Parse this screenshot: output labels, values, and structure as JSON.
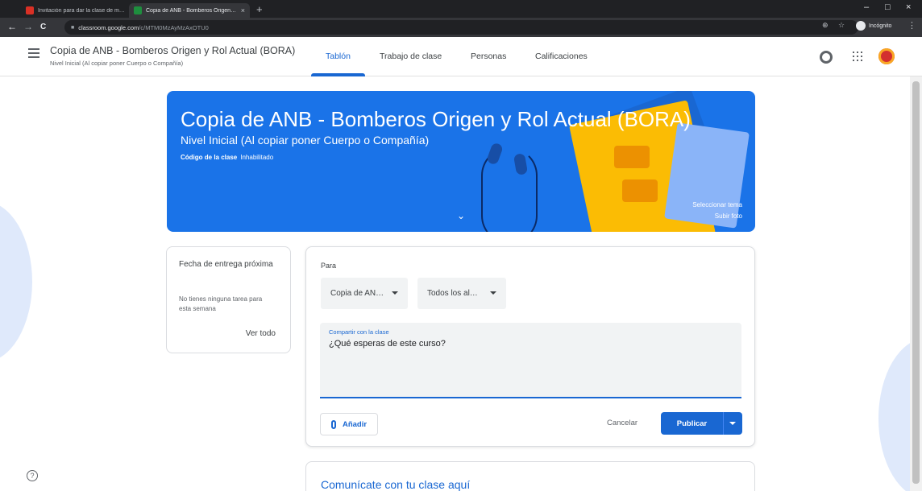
{
  "browser": {
    "tabs": [
      {
        "title": "Invitación para dar la clase de m…",
        "close": "×"
      },
      {
        "title": "Copia de ANB - Bomberos Origen…",
        "close": "×"
      }
    ],
    "new_tab": "+",
    "window_controls": {
      "minimize": "–",
      "maximize": "□",
      "close": "×"
    },
    "nav": {
      "back": "←",
      "forward": "→",
      "reload": "C"
    },
    "url_host": "classroom.google.com",
    "url_path": "/c/MTM0MzAyMzAxOTU0",
    "toolbar_icons": {
      "zoom": "⊕",
      "star": "☆",
      "menu": "⋮"
    },
    "incognito_label": "Incógnito"
  },
  "app": {
    "course_title": "Copia de ANB - Bomberos Origen y Rol Actual (BORA)",
    "course_subtitle": "Nivel Inicial (Al copiar poner Cuerpo o Compañía)",
    "tabs": [
      {
        "label": "Tablón",
        "active": true
      },
      {
        "label": "Trabajo de clase",
        "active": false
      },
      {
        "label": "Personas",
        "active": false
      },
      {
        "label": "Calificaciones",
        "active": false
      }
    ],
    "accent": "#1967d2"
  },
  "banner": {
    "title": "Copia de ANB - Bomberos Origen y Rol Actual (BORA)",
    "subtitle": "Nivel Inicial (Al copiar poner Cuerpo o Compañía)",
    "code_label": "Código de la clase",
    "code_value": "Inhabilitado",
    "select_theme": "Seleccionar tema",
    "upload_photo": "Subir foto",
    "color": "#1a73e8"
  },
  "upcoming": {
    "title": "Fecha de entrega próxima",
    "empty": "No tienes ninguna tarea para esta semana",
    "view_all": "Ver todo"
  },
  "composer": {
    "for_label": "Para",
    "class_select": "Copia de AN…",
    "students_select": "Todos los al…",
    "share_label": "Compartir con la clase",
    "share_value": "¿Qué esperas de este curso?",
    "add_label": "Añadir",
    "cancel_label": "Cancelar",
    "publish_label": "Publicar"
  },
  "communicate": {
    "text": "Comunícate con tu clase aquí"
  },
  "help": "?"
}
